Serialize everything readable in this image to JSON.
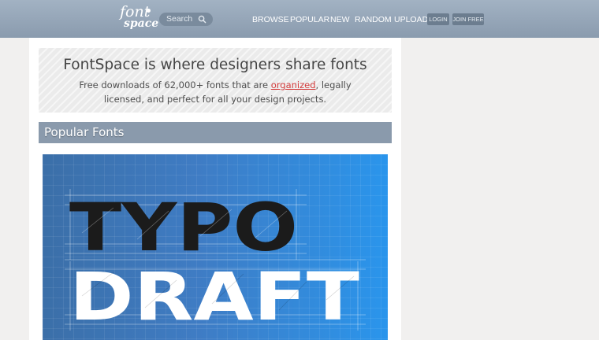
{
  "header": {
    "logo": {
      "line1": "font",
      "line2": "space"
    },
    "search": {
      "placeholder": "Search"
    },
    "nav": [
      "BROWSE",
      "POPULAR",
      "NEW",
      "RANDOM",
      "UPLOAD"
    ],
    "login_label": "LOGIN",
    "join_label": "JOIN FREE"
  },
  "hero": {
    "title": "FontSpace is where designers share fonts",
    "line_prefix": "Free downloads of 62,000+ fonts that are ",
    "line_link": "organized",
    "line_suffix": ", legally licensed, and perfect for all your design projects."
  },
  "section": {
    "title": "Popular Fonts"
  },
  "feature": {
    "word1": "TYPO",
    "word2": "DRAFT"
  },
  "colors": {
    "header": "#8a9bae",
    "section_bar": "#8a9aac",
    "link": "#d33b3b",
    "feature_blue": "#2a95ec"
  }
}
